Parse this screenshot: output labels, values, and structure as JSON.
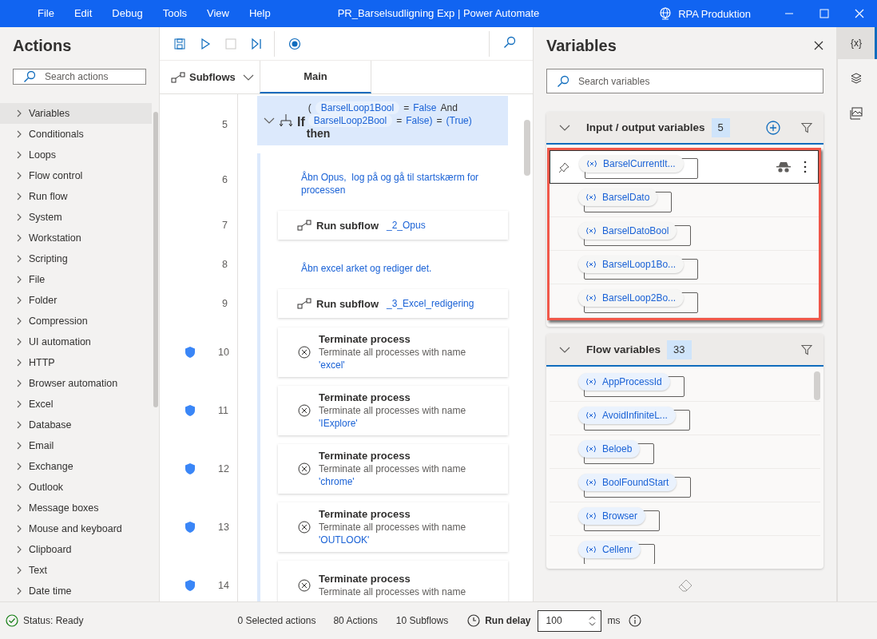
{
  "window": {
    "title": "PR_Barselsudligning Exp | Power Automate",
    "environment": "RPA Produktion"
  },
  "menu": [
    "File",
    "Edit",
    "Debug",
    "Tools",
    "View",
    "Help"
  ],
  "actions_panel": {
    "title": "Actions",
    "search": {
      "placeholder": "Search actions"
    },
    "items": [
      {
        "label": "Variables",
        "selected": true
      },
      {
        "label": "Conditionals",
        "selected": false
      },
      {
        "label": "Loops",
        "selected": false
      },
      {
        "label": "Flow control",
        "selected": false
      },
      {
        "label": "Run flow",
        "selected": false
      },
      {
        "label": "System",
        "selected": false
      },
      {
        "label": "Workstation",
        "selected": false
      },
      {
        "label": "Scripting",
        "selected": false
      },
      {
        "label": "File",
        "selected": false
      },
      {
        "label": "Folder",
        "selected": false
      },
      {
        "label": "Compression",
        "selected": false
      },
      {
        "label": "UI automation",
        "selected": false
      },
      {
        "label": "HTTP",
        "selected": false
      },
      {
        "label": "Browser automation",
        "selected": false
      },
      {
        "label": "Excel",
        "selected": false
      },
      {
        "label": "Database",
        "selected": false
      },
      {
        "label": "Email",
        "selected": false
      },
      {
        "label": "Exchange",
        "selected": false
      },
      {
        "label": "Outlook",
        "selected": false
      },
      {
        "label": "Message boxes",
        "selected": false
      },
      {
        "label": "Mouse and keyboard",
        "selected": false
      },
      {
        "label": "Clipboard",
        "selected": false
      },
      {
        "label": "Text",
        "selected": false
      },
      {
        "label": "Date time",
        "selected": false
      }
    ]
  },
  "designer": {
    "subflows_label": "Subflows",
    "tabs": [
      {
        "label": "Main",
        "selected": true
      }
    ],
    "steps": [
      {
        "line": "5",
        "kind": "if",
        "shield": false,
        "expanded": true,
        "keyword": "If",
        "condition": [
          [
            {
              "kind": "op",
              "text": "("
            },
            {
              "kind": "var",
              "text": "BarselLoop1Bool"
            },
            {
              "kind": "op",
              "text": "="
            },
            {
              "kind": "value",
              "text": "False"
            },
            {
              "kind": "op",
              "text": "And"
            }
          ],
          [
            {
              "kind": "var",
              "text": "BarselLoop2Bool"
            },
            {
              "kind": "op",
              "text": "="
            },
            {
              "kind": "value",
              "text": "False)"
            },
            {
              "kind": "op",
              "text": "="
            },
            {
              "kind": "value",
              "text": "(True)"
            }
          ]
        ],
        "closing": "then",
        "children": [
          {
            "line": "6",
            "kind": "comment",
            "shield": false,
            "text": "Åbn Opus,  log på og gå til startskærm for processen"
          },
          {
            "line": "7",
            "kind": "subflow",
            "shield": false,
            "title": "Run subflow",
            "target": "_2_Opus"
          },
          {
            "line": "8",
            "kind": "comment",
            "shield": false,
            "text": "Åbn excel arket og rediger det."
          },
          {
            "line": "9",
            "kind": "subflow",
            "shield": false,
            "title": "Run subflow",
            "target": "_3_Excel_redigering"
          },
          {
            "line": "10",
            "kind": "terminate",
            "shield": true,
            "title": "Terminate process",
            "description": "Terminate all processes with name",
            "value": "'excel'"
          },
          {
            "line": "11",
            "kind": "terminate",
            "shield": true,
            "title": "Terminate process",
            "description": "Terminate all processes with name",
            "value": "'IExplore'"
          },
          {
            "line": "12",
            "kind": "terminate",
            "shield": true,
            "title": "Terminate process",
            "description": "Terminate all processes with name",
            "value": "'chrome'"
          },
          {
            "line": "13",
            "kind": "terminate",
            "shield": true,
            "title": "Terminate process",
            "description": "Terminate all processes with name",
            "value": "'OUTLOOK'"
          },
          {
            "line": "14",
            "kind": "terminate",
            "shield": true,
            "title": "Terminate process",
            "description": "Terminate all processes with name"
          }
        ]
      }
    ]
  },
  "variables_panel": {
    "title": "Variables",
    "search": {
      "placeholder": "Search variables"
    },
    "sections": [
      {
        "title": "Input / output variables",
        "count": "5",
        "expanded": true,
        "can_add": true,
        "highlighted": true,
        "variables": [
          {
            "name": "BarselCurrentIt...",
            "selected": true
          },
          {
            "name": "BarselDato",
            "selected": false
          },
          {
            "name": "BarselDatoBool",
            "selected": false
          },
          {
            "name": "BarselLoop1Bo...",
            "selected": false
          },
          {
            "name": "BarselLoop2Bo...",
            "selected": false
          }
        ]
      },
      {
        "title": "Flow variables",
        "count": "33",
        "expanded": true,
        "can_add": false,
        "highlighted": false,
        "variables": [
          {
            "name": "AppProcessId",
            "selected": false
          },
          {
            "name": "AvoidInfiniteL...",
            "selected": false
          },
          {
            "name": "Beloeb",
            "selected": false
          },
          {
            "name": "BoolFoundStart",
            "selected": false
          },
          {
            "name": "Browser",
            "selected": false
          },
          {
            "name": "Cellenr",
            "selected": false
          }
        ]
      }
    ]
  },
  "side_rail": [
    {
      "kind": "variables",
      "label": "{x}",
      "selected": true
    },
    {
      "kind": "layers",
      "selected": false
    },
    {
      "kind": "images",
      "selected": false
    }
  ],
  "status_bar": {
    "status": "Status: Ready",
    "selected_actions": "0 Selected actions",
    "actions": "80 Actions",
    "subflows": "10 Subflows",
    "run_delay_label": "Run delay",
    "run_delay": "100",
    "unit": "ms"
  }
}
